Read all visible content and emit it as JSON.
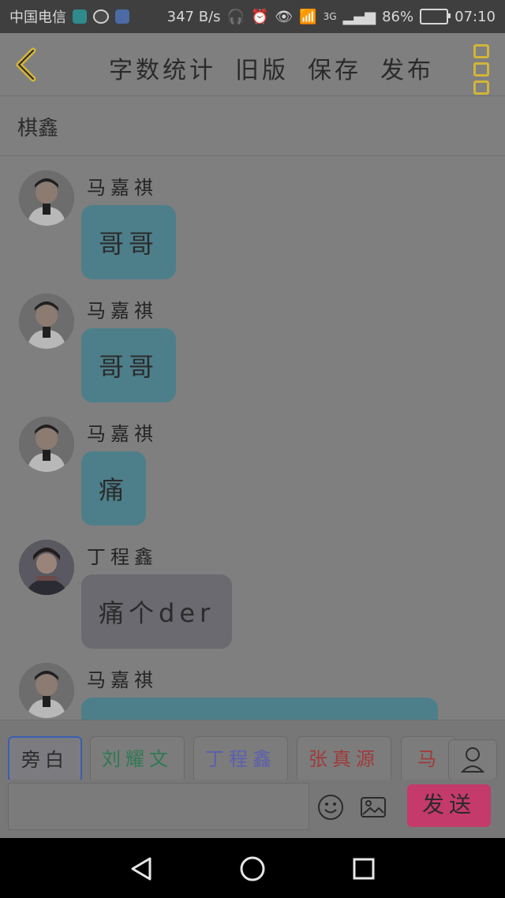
{
  "status_bar": {
    "carrier": "中国电信",
    "speed": "347 B/s",
    "network": "3G",
    "battery": "86%",
    "time": "07:10",
    "left_icons": [
      "shield-icon",
      "wechat-icon",
      "app-icon"
    ],
    "right_icons": [
      "headset-icon",
      "alarm-icon",
      "eye-icon",
      "wifi-icon",
      "signal-icon",
      "battery-icon"
    ]
  },
  "toolbar": {
    "word_count": "字数统计",
    "old_version": "旧版",
    "save": "保存",
    "publish": "发布",
    "accent_color": "#d2b43a"
  },
  "chat": {
    "title": "棋鑫"
  },
  "messages": [
    {
      "sender": "马嘉祺",
      "text": "哥哥",
      "style": "teal"
    },
    {
      "sender": "马嘉祺",
      "text": "哥哥",
      "style": "teal"
    },
    {
      "sender": "马嘉祺",
      "text": "痛",
      "style": "teal"
    },
    {
      "sender": "丁程鑫",
      "text": "痛个der",
      "style": "grey"
    },
    {
      "sender": "马嘉祺",
      "text": "",
      "style": "teal"
    }
  ],
  "roles": {
    "items": [
      {
        "label": "旁白",
        "color": "#2b2b2b"
      },
      {
        "label": "刘耀文",
        "color": "#2f7a52"
      },
      {
        "label": "丁程鑫",
        "color": "#5b5fb0"
      },
      {
        "label": "张真源",
        "color": "#a13a3a"
      },
      {
        "label": "马嘉",
        "color": "#a13a3a"
      }
    ],
    "selected": "旁白"
  },
  "composer": {
    "send_label": "发送",
    "send_color": "#c43a6a"
  }
}
